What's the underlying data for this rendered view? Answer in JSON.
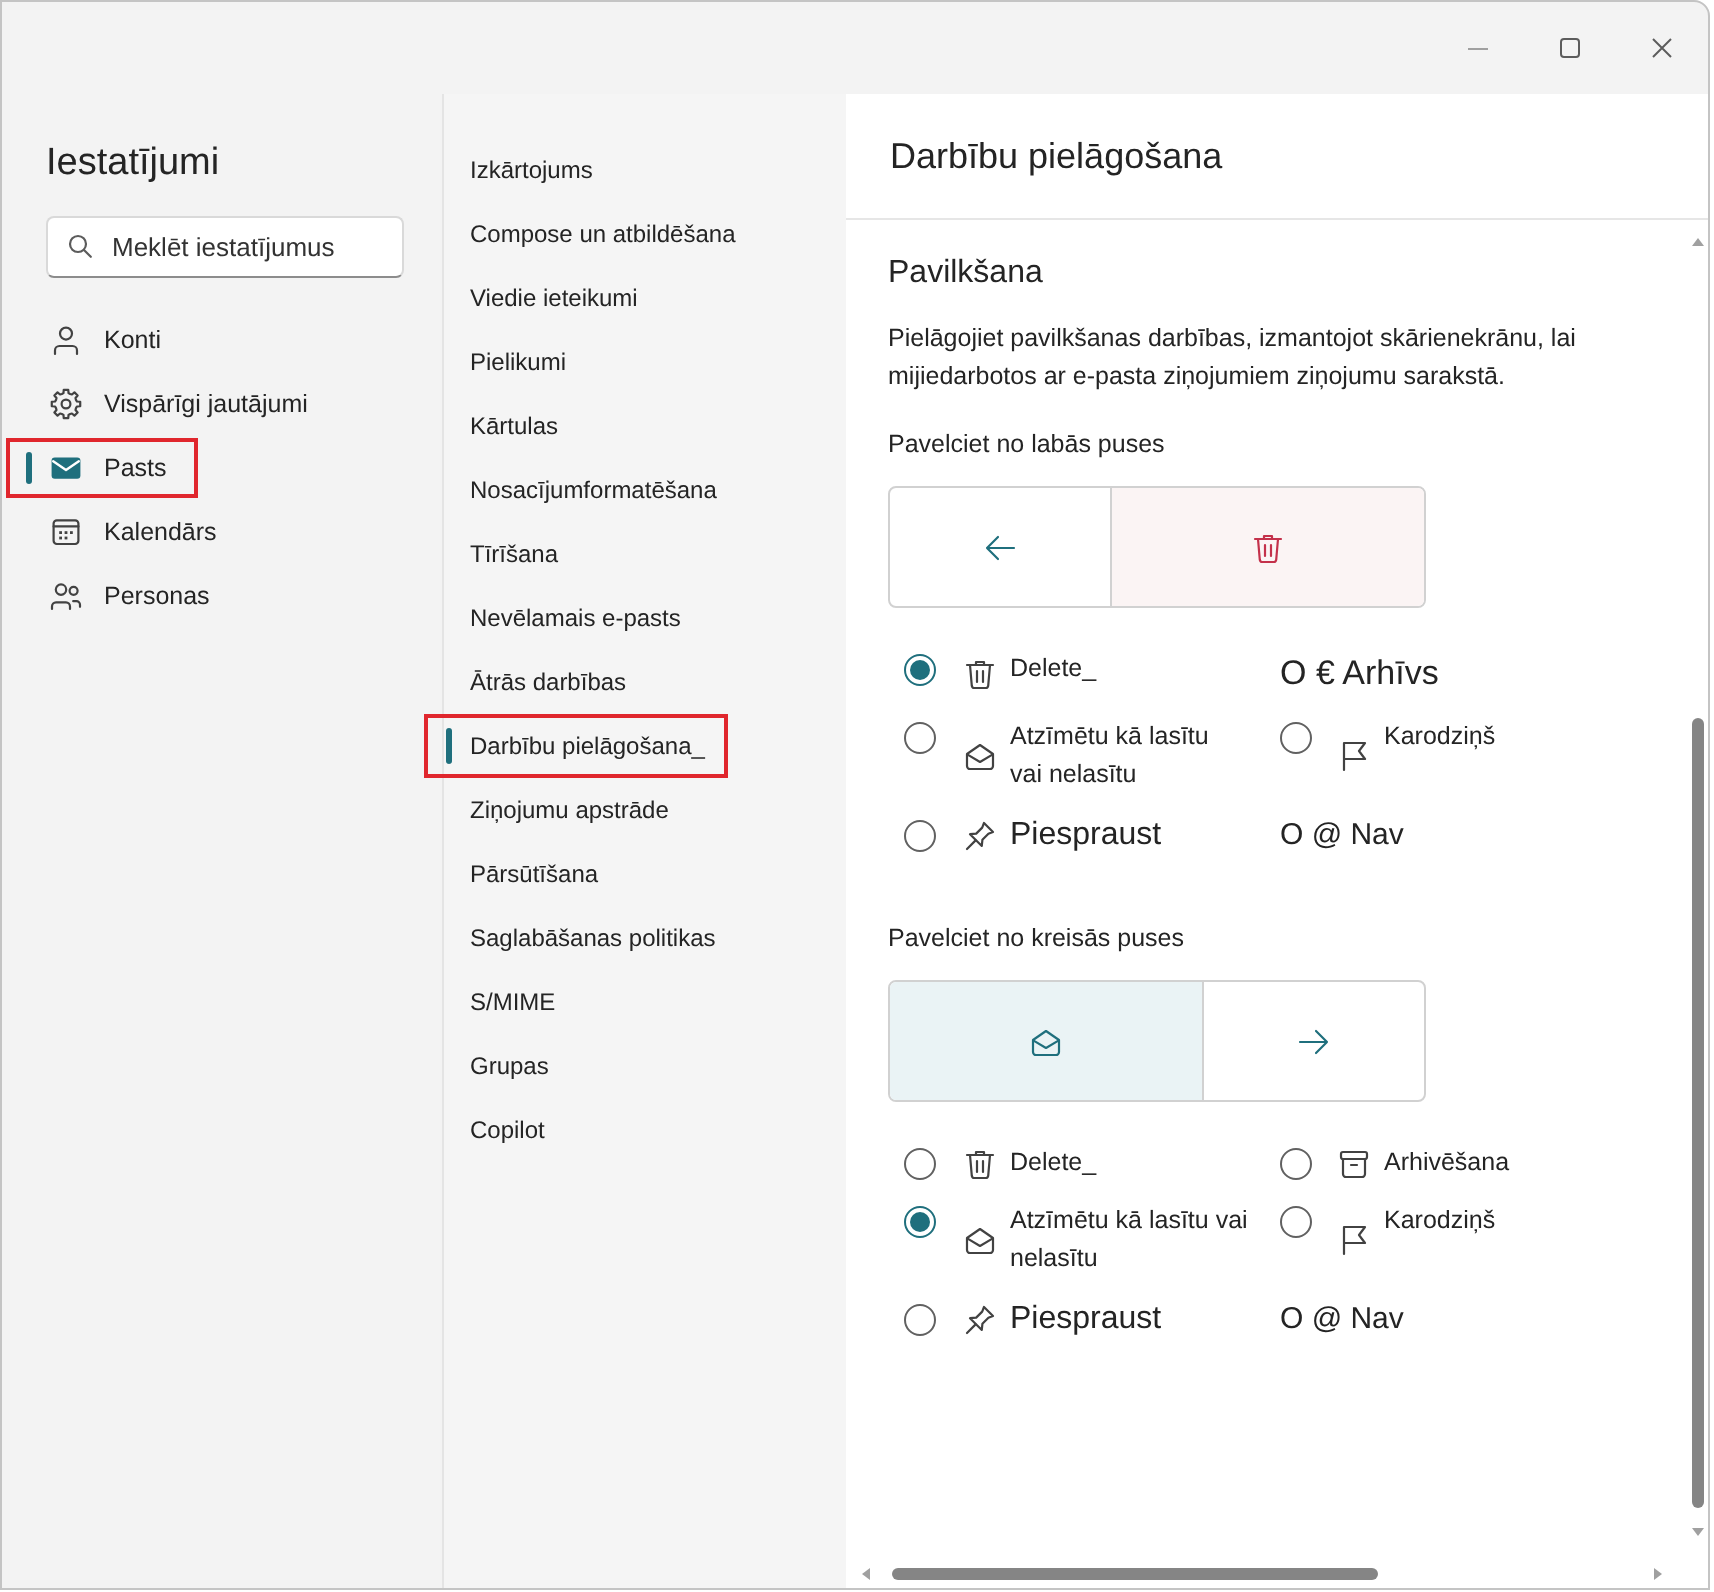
{
  "sidebar": {
    "title": "Iestatījumi",
    "search": {
      "placeholder": "Meklēt iestatījumus"
    },
    "items": [
      {
        "label": "Konti",
        "selected": false,
        "highlighted": false
      },
      {
        "label": "Vispārīgi jautājumi",
        "selected": false,
        "highlighted": false
      },
      {
        "label": "Pasts",
        "selected": true,
        "highlighted": true
      },
      {
        "label": "Kalendārs",
        "selected": false,
        "highlighted": false
      },
      {
        "label": "Personas",
        "selected": false,
        "highlighted": false
      }
    ]
  },
  "submenu": {
    "items": [
      {
        "label": "Izkārtojums",
        "selected": false,
        "highlighted": false
      },
      {
        "label": "Compose un atbildēšana",
        "selected": false,
        "highlighted": false
      },
      {
        "label": "Viedie ieteikumi",
        "selected": false,
        "highlighted": false
      },
      {
        "label": "Pielikumi",
        "selected": false,
        "highlighted": false
      },
      {
        "label": "Kārtulas",
        "selected": false,
        "highlighted": false
      },
      {
        "label": "Nosacījumformatēšana",
        "selected": false,
        "highlighted": false
      },
      {
        "label": "Tīrīšana",
        "selected": false,
        "highlighted": false
      },
      {
        "label": "Nevēlamais e-pasts",
        "selected": false,
        "highlighted": false
      },
      {
        "label": "Ātrās darbības",
        "selected": false,
        "highlighted": false
      },
      {
        "label": "Darbību pielāgošana_",
        "selected": true,
        "highlighted": true
      },
      {
        "label": "Ziņojumu apstrāde",
        "selected": false,
        "highlighted": false
      },
      {
        "label": "Pārsūtīšana",
        "selected": false,
        "highlighted": false
      },
      {
        "label": "Saglabāšanas politikas",
        "selected": false,
        "highlighted": false
      },
      {
        "label": "S/MIME",
        "selected": false,
        "highlighted": false
      },
      {
        "label": "Grupas",
        "selected": false,
        "highlighted": false
      },
      {
        "label": "Copilot",
        "selected": false,
        "highlighted": false
      }
    ]
  },
  "content": {
    "title": "Darbību pielāgošana",
    "section": "Pavilkšana",
    "description": "Pielāgojiet pavilkšanas darbības, izmantojot skārienekrānu, lai mijiedarbotos ar e-pasta ziņojumiem ziņojumu sarakstā.",
    "groups": [
      {
        "label": "Pavelciet no labās puses",
        "action_on_left": false,
        "options": [
          {
            "kind": "radio",
            "label": "Delete_",
            "selected": true
          },
          {
            "kind": "text",
            "label": "O € Arhīvs"
          },
          {
            "kind": "radio",
            "label": "Atzīmētu kā lasītu vai nelasītu",
            "selected": false
          },
          {
            "kind": "radio",
            "label": "Karodziņš",
            "selected": false
          },
          {
            "kind": "radio",
            "label": "Piespraust",
            "selected": false
          },
          {
            "kind": "text",
            "label": "O @ Nav"
          }
        ]
      },
      {
        "label": "Pavelciet no kreisās puses",
        "action_on_left": true,
        "options": [
          {
            "kind": "radio",
            "label": "Delete_",
            "selected": false
          },
          {
            "kind": "radio",
            "label": "Arhivēšana",
            "selected": false
          },
          {
            "kind": "radio",
            "label": "Atzīmētu kā lasītu vai nelasītu",
            "selected": true
          },
          {
            "kind": "radio",
            "label": "Karodziņš",
            "selected": false
          },
          {
            "kind": "radio",
            "label": "Piespraust",
            "selected": false
          },
          {
            "kind": "text",
            "label": "O @ Nav"
          }
        ]
      }
    ]
  }
}
